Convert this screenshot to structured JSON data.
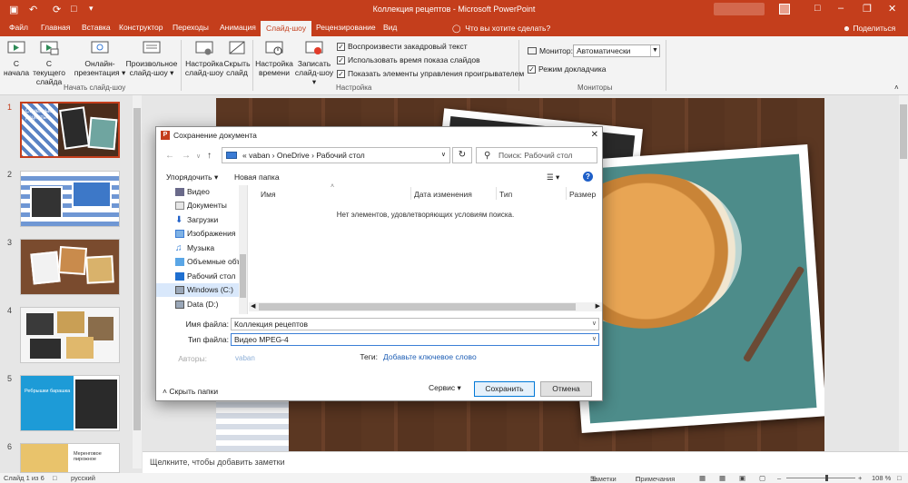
{
  "window": {
    "title": "Коллекция рецептов - Microsoft PowerPoint",
    "tell_me": "Что вы хотите сделать?",
    "share": "Поделиться"
  },
  "tabs": [
    "Файл",
    "Главная",
    "Вставка",
    "Конструктор",
    "Переходы",
    "Анимация",
    "Слайд-шоу",
    "Рецензирование",
    "Вид"
  ],
  "active_tab": "Слайд-шоу",
  "ribbon": {
    "start": {
      "from_start": "С начала",
      "from_current_1": "С текущего",
      "from_current_2": "слайда",
      "online_1": "Онлайн-",
      "online_2": "презентация ▾",
      "custom_1": "Произвольное",
      "custom_2": "слайд-шоу ▾",
      "group": "Начать слайд-шоу"
    },
    "setup": {
      "setup_1": "Настройка",
      "setup_2": "слайд-шоу",
      "hide_1": "Скрыть",
      "hide_2": "слайд",
      "timing_1": "Настройка",
      "timing_2": "времени",
      "record_1": "Записать",
      "record_2": "слайд-шоу ▾",
      "chk_narration": "Воспроизвести закадровый текст",
      "chk_timings": "Использовать время показа слайдов",
      "chk_controls": "Показать элементы управления проигрывателем",
      "group": "Настройка"
    },
    "monitors": {
      "monitor_label": "Монитор:",
      "monitor_value": "Автоматически",
      "presenter": "Режим докладчика",
      "group": "Мониторы"
    }
  },
  "thumbnails": [
    {
      "num": "1",
      "title": "Семейные рецепты"
    },
    {
      "num": "2"
    },
    {
      "num": "3"
    },
    {
      "num": "4"
    },
    {
      "num": "5",
      "title": "Ребрышки барашка"
    },
    {
      "num": "6",
      "title": "Меренговое пирожное"
    }
  ],
  "notes_placeholder": "Щелкните, чтобы добавить заметки",
  "status": {
    "slide": "Слайд 1 из 6",
    "lang": "русский",
    "notes": "Заметки",
    "comments": "Примечания",
    "zoom": "108 %"
  },
  "dialog": {
    "title": "Сохранение документа",
    "path": [
      "«",
      "vaban",
      "›",
      "OneDrive",
      "›",
      "Рабочий стол"
    ],
    "search_placeholder": "Поиск: Рабочий стол",
    "organize": "Упорядочить ▾",
    "new_folder": "Новая папка",
    "tree": [
      "Видео",
      "Документы",
      "Загрузки",
      "Изображения",
      "Музыка",
      "Объемные объ",
      "Рабочий стол",
      "Windows (C:)",
      "Data (D:)"
    ],
    "columns": [
      "Имя",
      "Дата изменения",
      "Тип",
      "Размер"
    ],
    "empty": "Нет элементов, удовлетворяющих условиям поиска.",
    "filename_label": "Имя файла:",
    "filename": "Коллекция рецептов",
    "filetype_label": "Тип файла:",
    "filetype": "Видео MPEG-4",
    "authors_label": "Авторы:",
    "authors": "vaban",
    "tags_label": "Теги:",
    "tags_value": "Добавьте ключевое слово",
    "hide_folders": "Скрыть папки",
    "service": "Сервис",
    "save": "Сохранить",
    "cancel": "Отмена"
  },
  "colors": {
    "accent": "#c43e1c",
    "link": "#1f5fb5"
  }
}
